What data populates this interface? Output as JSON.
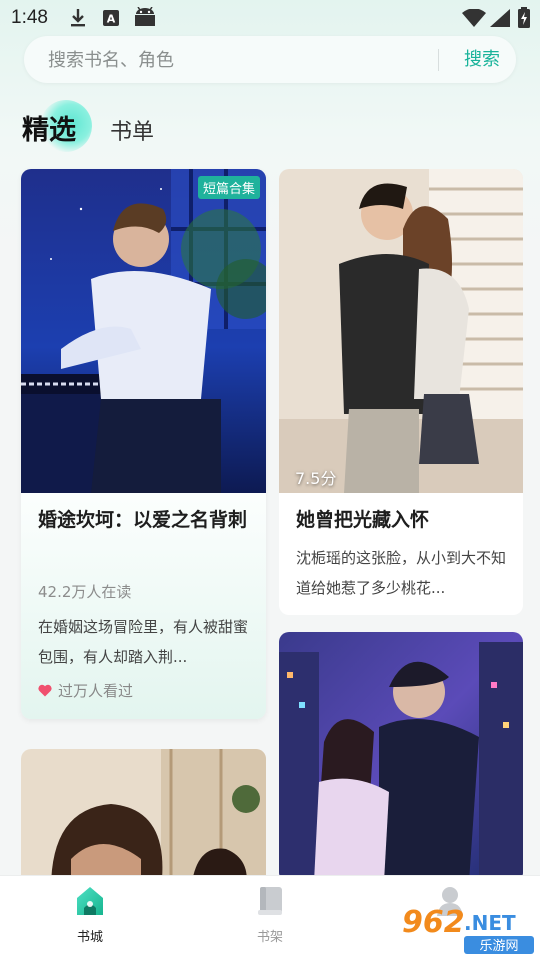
{
  "status_bar": {
    "time": "1:48",
    "icons": [
      "download-icon",
      "a-notification-icon",
      "android-icon",
      "wifi-icon",
      "signal-icon",
      "battery-charging-icon"
    ]
  },
  "search": {
    "placeholder": "搜索书名、角色",
    "button_label": "搜索"
  },
  "tabs": [
    {
      "label": "精选",
      "active": true
    },
    {
      "label": "书单",
      "active": false
    }
  ],
  "books": [
    {
      "badge": "短篇合集",
      "title": "婚途坎坷：以爱之名背刺",
      "readers": "42.2万人在读",
      "description": "在婚姻这场冒险里，有人被甜蜜包围，有人却踏入荆...",
      "hot_label": "过万人看过",
      "cover_theme": "night-piano"
    },
    {
      "score": "7.5分",
      "title": "她曾把光藏入怀",
      "description": "沈栀瑶的这张脸，从小到大不知道给她惹了多少桃花...",
      "cover_theme": "couple-window"
    },
    {
      "cover_theme": "neon-city-couple"
    },
    {
      "cover_theme": "sepia-room"
    }
  ],
  "bottom_nav": [
    {
      "label": "书城",
      "icon": "home-icon",
      "active": true
    },
    {
      "label": "书架",
      "icon": "bookshelf-icon",
      "active": false
    },
    {
      "label": "",
      "icon": "profile-icon",
      "active": false
    }
  ],
  "watermark": {
    "text": "962.NET",
    "subtext": "乐游网"
  },
  "colors": {
    "accent": "#19b39a",
    "badge": "#1fb29c",
    "heart": "#f0506e"
  }
}
